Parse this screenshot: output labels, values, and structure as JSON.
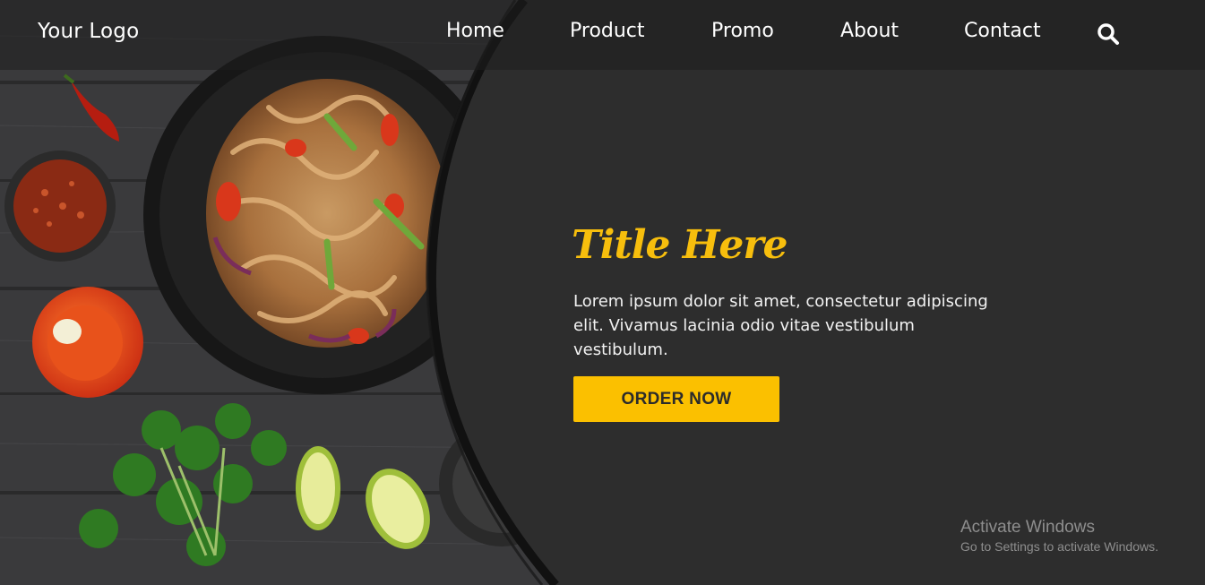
{
  "nav": {
    "logo": "Your Logo",
    "links": [
      "Home",
      "Product",
      "Promo",
      "About",
      "Contact"
    ],
    "search_icon": "search-icon"
  },
  "hero": {
    "title": "Title Here",
    "text": "Lorem ipsum dolor sit amet, consectetur adipiscing elit. Vivamus lacinia odio vitae vestibulum vestibulum.",
    "button": "ORDER NOW"
  },
  "watermark": {
    "title": "Activate Windows",
    "subtitle": "Go to Settings to activate Windows."
  },
  "colors": {
    "accent": "#fbc000",
    "title": "#f7be0d",
    "panel": "#2d2d2d",
    "wood": "#3c3c3e"
  }
}
